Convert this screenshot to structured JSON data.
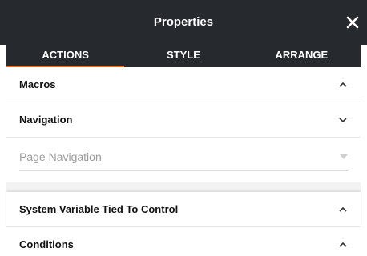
{
  "header": {
    "title": "Properties"
  },
  "tabs": [
    {
      "label": "ACTIONS",
      "active": true
    },
    {
      "label": "STYLE",
      "active": false
    },
    {
      "label": "ARRANGE",
      "active": false
    }
  ],
  "sections": {
    "macros": {
      "label": "Macros",
      "icon": "chevron-up-icon"
    },
    "navigation": {
      "label": "Navigation",
      "icon": "chevron-down-icon",
      "select": {
        "placeholder": "Page Navigation"
      }
    },
    "system_variable": {
      "label": "System Variable Tied To Control",
      "icon": "chevron-up-icon"
    },
    "conditions": {
      "label": "Conditions",
      "icon": "chevron-up-icon"
    }
  },
  "colors": {
    "header_bg": "#262a2e",
    "accent": "#f26a21"
  }
}
